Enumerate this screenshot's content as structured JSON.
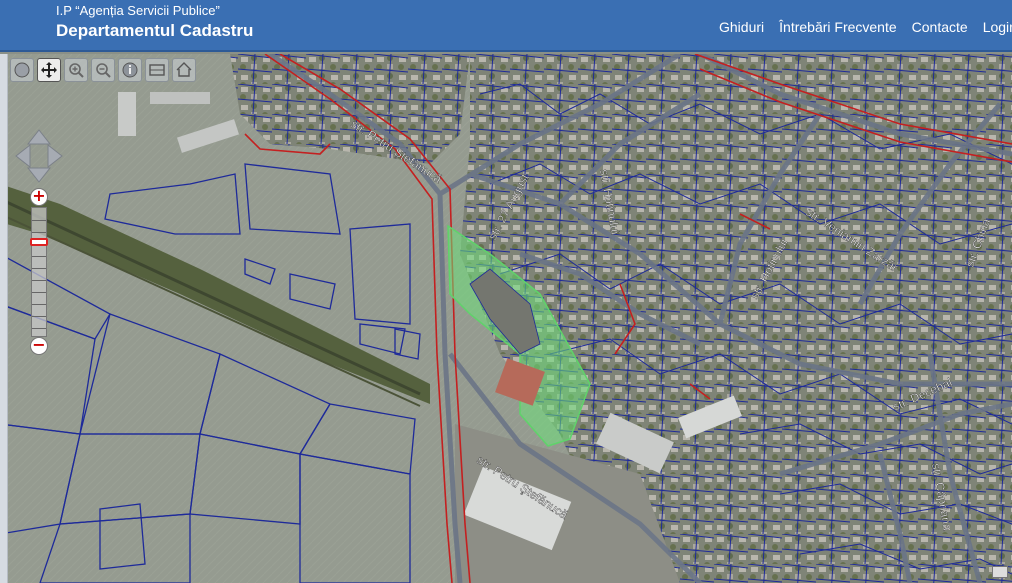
{
  "header": {
    "agency": "I.P “Agenția Servicii Publice”",
    "department": "Departamentul Cadastru"
  },
  "nav": {
    "items": [
      "Ghiduri",
      "Întrebări Frecvente",
      "Contacte",
      "Login"
    ]
  },
  "map": {
    "street_labels": {
      "petru_stefanuca_top": "str. Petru Ştefănucă",
      "petru_stefanuca_bottom": "str. Petru Ştefănucă",
      "aug27": "str. 27 August",
      "hotinului_a": "str. Hotinului",
      "hotinului_b": "str. Hotinului",
      "veniamin_zarzar": "str. Veniamin Zarzăr",
      "china": "str. China",
      "decebal": "str. Decebal",
      "capriana": "str. Căpriana"
    },
    "colors": {
      "parcel_line": "#1e2a9a",
      "road_boundary": "#c42020",
      "selected_fill": "#6ee07a",
      "header_bg": "#3a6fb3"
    }
  },
  "toolbar": {
    "tools": [
      "globe-icon",
      "pan-icon",
      "zoom-in-icon",
      "zoom-out-icon",
      "info-icon",
      "measure-icon",
      "home-icon"
    ],
    "zoom_plus": "+",
    "zoom_minus": "−"
  }
}
